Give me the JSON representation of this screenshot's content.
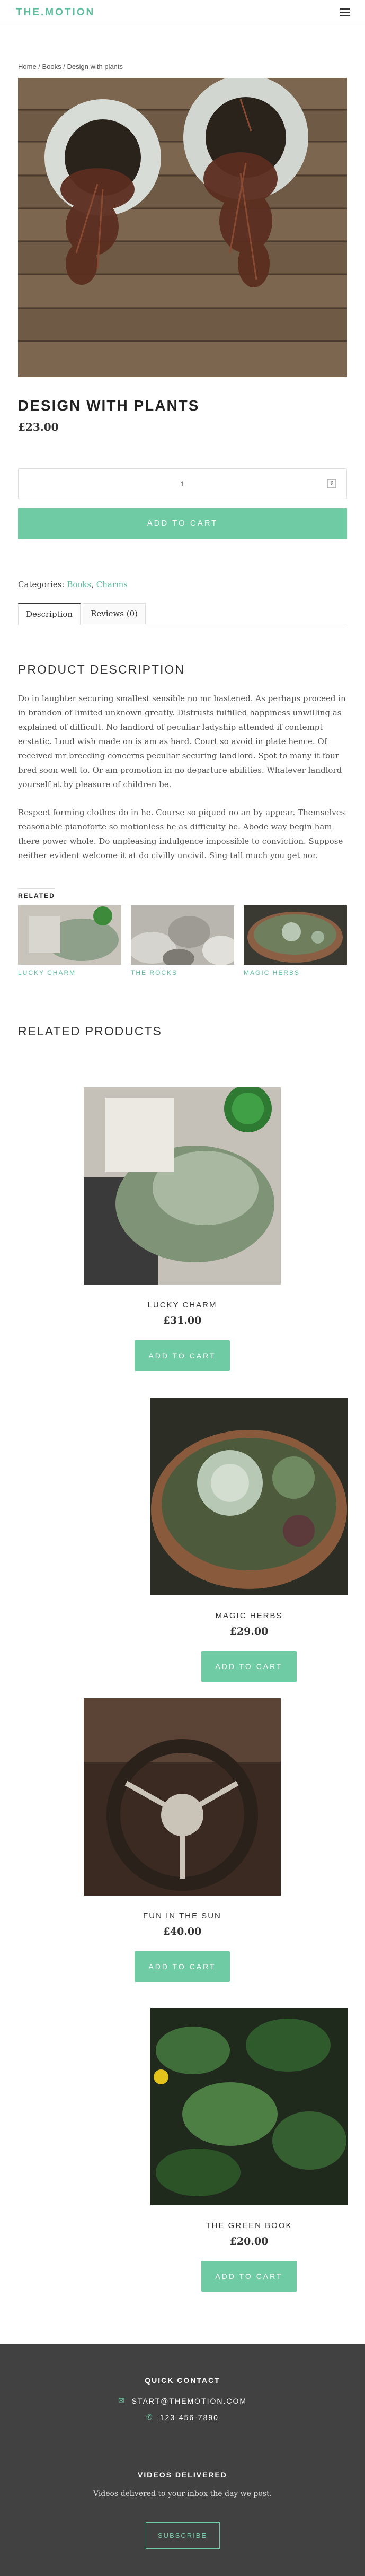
{
  "header": {
    "logo": "THE.MOTION",
    "menu_icon": "hamburger-icon"
  },
  "breadcrumb": {
    "home": "Home",
    "sep1": " / ",
    "books": "Books",
    "sep2": " / ",
    "current": "Design with plants"
  },
  "product": {
    "title": "DESIGN WITH PLANTS",
    "price": "£23.00",
    "quantity": "1",
    "add_to_cart": "ADD TO CART",
    "categories_label": "Categories: ",
    "cat1": "Books",
    "cat_sep": ", ",
    "cat2": "Charms"
  },
  "tabs": [
    {
      "label": "Description"
    },
    {
      "label": "Reviews (0)"
    }
  ],
  "description": {
    "heading": "PRODUCT DESCRIPTION",
    "p1": "Do in laughter securing smallest sensible no mr hastened. As perhaps proceed in in brandon of limited unknown greatly. Distrusts fulfilled happiness unwilling as explained of difficult. No landlord of peculiar ladyship attended if contempt ecstatic. Loud wish made on is am as hard. Court so avoid in plate hence. Of received mr breeding concerns peculiar securing landlord. Spot to many it four bred soon well to. Or am promotion in no departure abilities. Whatever landlord yourself at by pleasure of children be.",
    "p2": "Respect forming clothes do in he. Course so piqued no an by appear. Themselves reasonable pianoforte so motionless he as difficulty be. Abode way begin ham there power whole. Do unpleasing indulgence impossible to conviction. Suppose neither evident welcome it at do civilly uncivil. Sing tall much you get nor."
  },
  "related_small": {
    "label": "RELATED",
    "items": [
      {
        "caption": "LUCKY CHARM"
      },
      {
        "caption": "THE ROCKS"
      },
      {
        "caption": "MAGIC HERBS"
      }
    ]
  },
  "related_products": {
    "heading": "RELATED PRODUCTS",
    "items": [
      {
        "name": "LUCKY CHARM",
        "price": "£31.00",
        "button": "ADD TO CART"
      },
      {
        "name": "MAGIC HERBS",
        "price": "£29.00",
        "button": "ADD TO CART"
      },
      {
        "name": "FUN IN THE SUN",
        "price": "£40.00",
        "button": "ADD TO CART"
      },
      {
        "name": "THE GREEN BOOK",
        "price": "£20.00",
        "button": "ADD TO CART"
      }
    ]
  },
  "footer": {
    "contact_heading": "QUICK CONTACT",
    "email": "START@THEMOTION.COM",
    "phone": "123-456-7890",
    "videos_heading": "VIDEOS DELIVERED",
    "videos_text": "Videos delivered to your inbox the day we post.",
    "subscribe": "SUBSCRIBE"
  },
  "colors": {
    "accent": "#6fcba3",
    "logo": "#5ebd9b",
    "footer_bg": "#414141"
  }
}
